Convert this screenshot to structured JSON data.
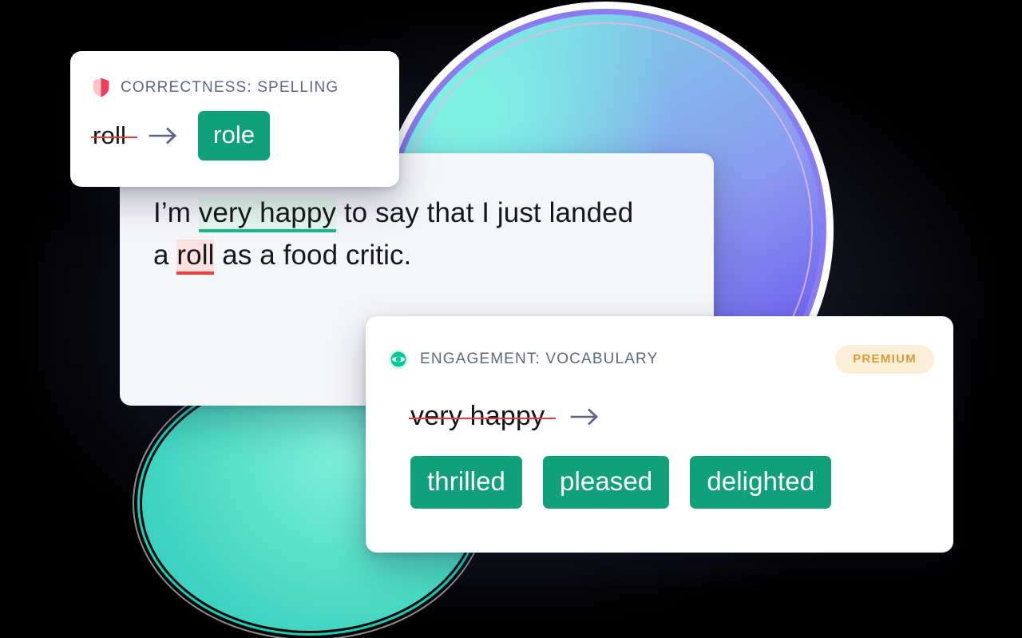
{
  "colors": {
    "chip_green": "#10a17c",
    "header_text": "#5d6785",
    "strike_red": "#ed3a3a",
    "highlight_green_bg": "#e4f7ee",
    "highlight_green_underline": "#13b98c",
    "highlight_red_bg": "#fbe0e0",
    "highlight_red_underline": "#e8443f",
    "premium_bg": "#fcefd8",
    "premium_text": "#d99a36",
    "card_white": "#ffffff",
    "card_sentence_bg": "#f5f6fa",
    "background": "#000000",
    "blob_blue": "#6f63ef",
    "blob_teal": "#3fd3c0"
  },
  "correctness_card": {
    "icon": "shield-icon",
    "title": "CORRECTNESS: SPELLING",
    "original_word": "roll",
    "arrow": "arrow-right-icon",
    "suggestion": "role"
  },
  "sentence_card": {
    "line1_prefix": "I’m ",
    "line1_highlight": "very happy",
    "line1_suffix": " to say that I just landed",
    "line2_prefix": "a ",
    "line2_highlight": "roll",
    "line2_suffix": " as a food critic.",
    "full_text": "I’m very happy to say that I just landed a roll as a food critic."
  },
  "engagement_card": {
    "icon": "engagement-dot-icon",
    "title": "ENGAGEMENT: VOCABULARY",
    "badge": "PREMIUM",
    "original_phrase": "very happy",
    "arrow": "arrow-right-icon",
    "suggestions": [
      "thrilled",
      "pleased",
      "delighted"
    ]
  }
}
